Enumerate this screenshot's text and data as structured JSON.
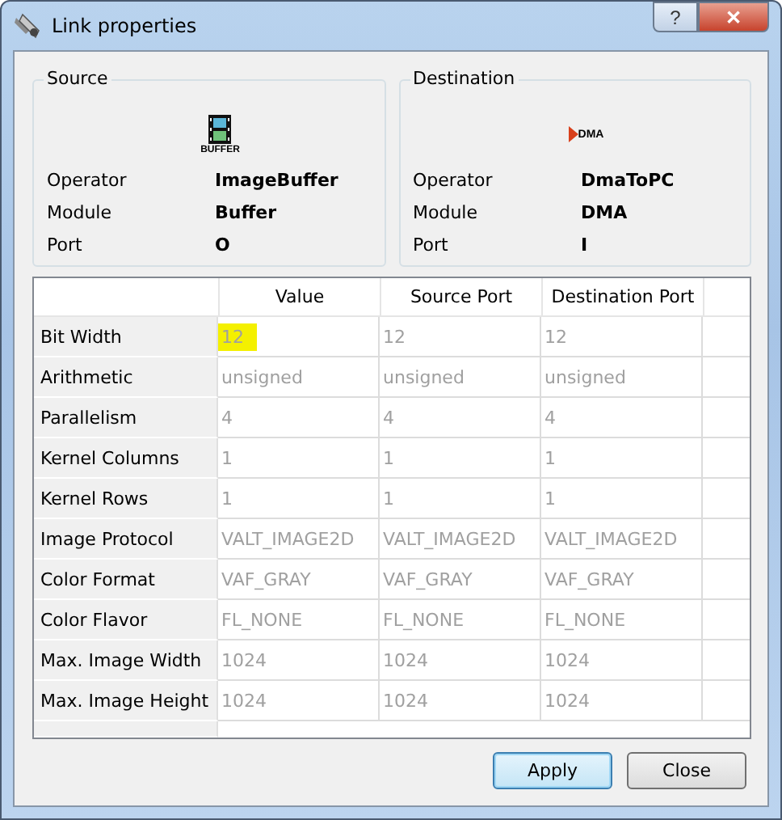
{
  "window": {
    "title": "Link properties",
    "buttons": [
      "?",
      "✕"
    ]
  },
  "groups": [
    {
      "title": "Source",
      "icon_label": "BUFFER",
      "kind": "buffer",
      "fields": [
        {
          "label": "Operator",
          "value": "ImageBuffer"
        },
        {
          "label": "Module",
          "value": "Buffer"
        },
        {
          "label": "Port",
          "value": "O"
        }
      ]
    },
    {
      "title": "Destination",
      "icon_label": "DMA",
      "kind": "dma",
      "fields": [
        {
          "label": "Operator",
          "value": "DmaToPC"
        },
        {
          "label": "Module",
          "value": "DMA"
        },
        {
          "label": "Port",
          "value": "I"
        }
      ]
    }
  ],
  "table": {
    "columns": [
      "Value",
      "Source Port",
      "Destination Port"
    ],
    "rows": [
      {
        "label": "Bit Width",
        "cells": [
          "12",
          "12",
          "12"
        ],
        "highlighted": true
      },
      {
        "label": "Arithmetic",
        "cells": [
          "unsigned",
          "unsigned",
          "unsigned"
        ],
        "highlighted": false
      },
      {
        "label": "Parallelism",
        "cells": [
          "4",
          "4",
          "4"
        ],
        "highlighted": false
      },
      {
        "label": "Kernel Columns",
        "cells": [
          "1",
          "1",
          "1"
        ],
        "highlighted": false
      },
      {
        "label": "Kernel Rows",
        "cells": [
          "1",
          "1",
          "1"
        ],
        "highlighted": false
      },
      {
        "label": "Image Protocol",
        "cells": [
          "VALT_IMAGE2D",
          "VALT_IMAGE2D",
          "VALT_IMAGE2D"
        ],
        "highlighted": false
      },
      {
        "label": "Color Format",
        "cells": [
          "VAF_GRAY",
          "VAF_GRAY",
          "VAF_GRAY"
        ],
        "highlighted": false
      },
      {
        "label": "Color Flavor",
        "cells": [
          "FL_NONE",
          "FL_NONE",
          "FL_NONE"
        ],
        "highlighted": false
      },
      {
        "label": "Max. Image Width",
        "cells": [
          "1024",
          "1024",
          "1024"
        ],
        "highlighted": false
      },
      {
        "label": "Max. Image Height",
        "cells": [
          "1024",
          "1024",
          "1024"
        ],
        "highlighted": false
      }
    ]
  },
  "buttons": [
    {
      "label": "Apply",
      "default": true
    },
    {
      "label": "Close",
      "default": false
    }
  ]
}
